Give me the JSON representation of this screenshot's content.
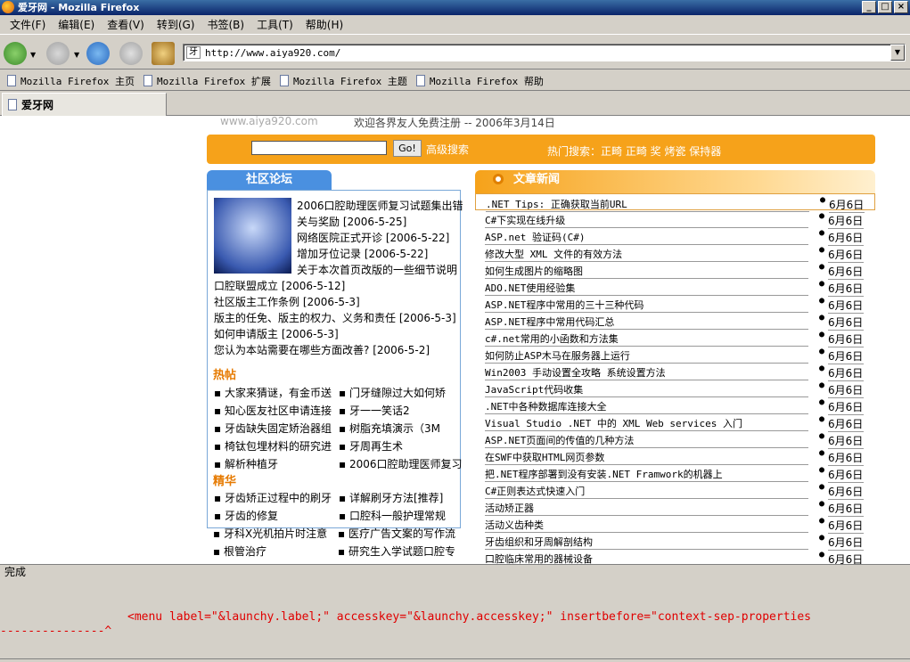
{
  "window": {
    "title": "爱牙网 - Mozilla Firefox"
  },
  "menu": [
    "文件(F)",
    "编辑(E)",
    "查看(V)",
    "转到(G)",
    "书签(B)",
    "工具(T)",
    "帮助(H)"
  ],
  "address": {
    "favicon_text": "牙",
    "url": "http://www.aiya920.com/"
  },
  "bookmarks": [
    "Mozilla Firefox 主页",
    "Mozilla Firefox 扩展",
    "Mozilla Firefox 主题",
    "Mozilla Firefox 帮助"
  ],
  "tab": {
    "label": "爱牙网"
  },
  "page": {
    "site_url": "www.aiya920.com",
    "welcome": "欢迎各界友人免费注册 -- 2006年3月14日",
    "search": {
      "go": "Go!",
      "advanced": "高级搜索",
      "hot": "热门搜索：正畸  正畸  奖  烤瓷  保持器"
    },
    "forum": {
      "title": "社区论坛",
      "posts": [
        {
          "text": "2006口腔助理医师复习试题集出错",
          "date": ""
        },
        {
          "text": "关与奖励",
          "date": "[2006-5-25]"
        },
        {
          "text": "网络医院正式开诊",
          "date": "[2006-5-22]"
        },
        {
          "text": "增加牙位记录",
          "date": "[2006-5-22]"
        },
        {
          "text": "关于本次首页改版的一些细节说明",
          "date": ""
        },
        {
          "text": "口腔联盟成立",
          "date": "[2006-5-12]"
        },
        {
          "text": "社区版主工作条例",
          "date": "[2006-5-3]"
        },
        {
          "text": "版主的任免、版主的权力、义务和责任",
          "date": "[2006-5-3]"
        },
        {
          "text": "如何申请版主",
          "date": "[2006-5-3]"
        },
        {
          "text": "您认为本站需要在哪些方面改善?",
          "date": "[2006-5-2]"
        }
      ],
      "hot_title": "热帖",
      "hot": [
        [
          "大家来猜谜，有金币送",
          "门牙缝隙过大如何矫"
        ],
        [
          "知心医友社区申请连接",
          "牙一一笑话2"
        ],
        [
          "牙齿缺失固定矫治器组",
          "树脂充填演示（3M"
        ],
        [
          "椅钛包埋材料的研究进",
          "牙周再生术"
        ],
        [
          "解析种植牙",
          "2006口腔助理医师复习"
        ]
      ],
      "best_title": "精华",
      "best": [
        [
          "牙齿矫正过程中的刷牙",
          "详解刷牙方法[推荐]"
        ],
        [
          "牙齿的修复",
          "口腔科一般护理常规"
        ],
        [
          "牙科X光机拍片时注意",
          "医疗广告文案的写作流"
        ],
        [
          "根管治疗",
          "研究生入学试题口腔专"
        ]
      ]
    },
    "news": {
      "title": "文章新闻",
      "items": [
        {
          "text": ".NET Tips: 正确获取当前URL",
          "date": "6月6日"
        },
        {
          "text": "C#下实现在线升级",
          "date": "6月6日"
        },
        {
          "text": "ASP.net 验证码(C#)",
          "date": "6月6日"
        },
        {
          "text": "修改大型 XML 文件的有效方法",
          "date": "6月6日"
        },
        {
          "text": "如何生成图片的缩略图",
          "date": "6月6日"
        },
        {
          "text": "ADO.NET使用经验集",
          "date": "6月6日"
        },
        {
          "text": "ASP.NET程序中常用的三十三种代码",
          "date": "6月6日"
        },
        {
          "text": "ASP.NET程序中常用代码汇总",
          "date": "6月6日"
        },
        {
          "text": "c#.net常用的小函数和方法集",
          "date": "6月6日"
        },
        {
          "text": "如何防止ASP木马在服务器上运行",
          "date": "6月6日"
        },
        {
          "text": "Win2003 手动设置全攻略 系统设置方法",
          "date": "6月6日"
        },
        {
          "text": "JavaScript代码收集",
          "date": "6月6日"
        },
        {
          "text": ".NET中各种数据库连接大全",
          "date": "6月6日"
        },
        {
          "text": "Visual Studio .NET 中的 XML Web services 入门",
          "date": "6月6日"
        },
        {
          "text": "ASP.NET页面间的传值的几种方法",
          "date": "6月6日"
        },
        {
          "text": "在SWF中获取HTML网页参数",
          "date": "6月6日"
        },
        {
          "text": "把.NET程序部署到没有安装.NET Framwork的机器上",
          "date": "6月6日"
        },
        {
          "text": "C#正则表达式快速入门",
          "date": "6月6日"
        },
        {
          "text": "活动矫正器",
          "date": "6月6日"
        },
        {
          "text": "活动义齿种类",
          "date": "6月6日"
        },
        {
          "text": "牙齿组织和牙周解剖结构",
          "date": "6月6日"
        },
        {
          "text": "口腔临床常用的器械设备",
          "date": "6月6日"
        }
      ]
    }
  },
  "status": {
    "text": "完成"
  },
  "error": {
    "line": "<menu label=\"&launchy.label;\" accesskey=\"&launchy.accesskey;\" insertbefore=\"context-sep-properties",
    "pointer": "---------------^"
  }
}
